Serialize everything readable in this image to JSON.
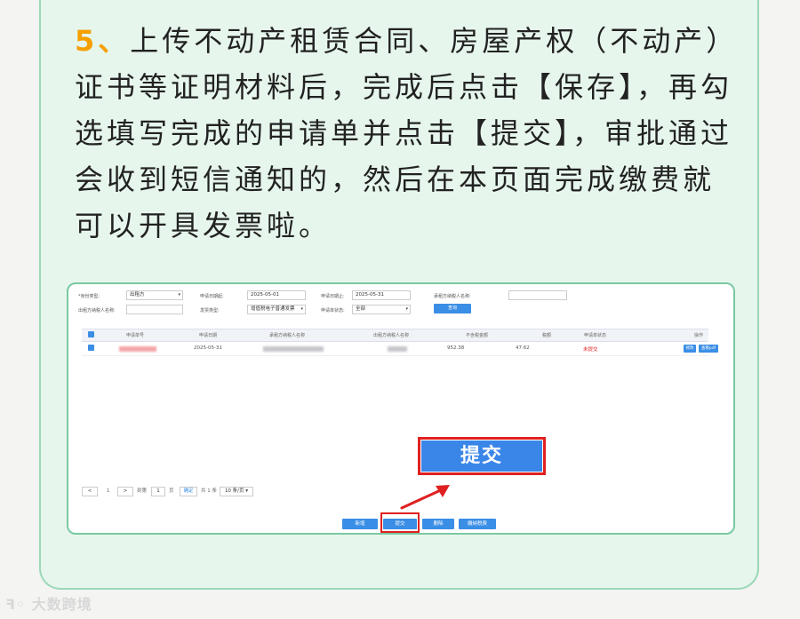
{
  "instruction": {
    "number": "5、",
    "text": "上传不动产租赁合同、房屋产权（不动产）证书等证明材料后，完成后点击【保存】，再勾选填写完成的申请单并点击【提交】，审批通过会收到短信通知的，然后在本页面完成缴费就可以开具发票啦。"
  },
  "form": {
    "row1": [
      {
        "label": "*身份类型:",
        "value": "出租方",
        "type": "select"
      },
      {
        "label": "申请日期起:",
        "value": "2025-05-01",
        "type": "input"
      },
      {
        "label": "申请日期止:",
        "value": "2025-05-31",
        "type": "input"
      },
      {
        "label": "承租方纳税人名称:",
        "value": "",
        "type": "input"
      }
    ],
    "row2": [
      {
        "label": "出租方纳税人名称:",
        "value": "",
        "type": "input"
      },
      {
        "label": "发票类型:",
        "value": "增值税电子普通发票",
        "type": "select"
      },
      {
        "label": "申请单状态:",
        "value": "全部",
        "type": "select"
      }
    ],
    "query_label": "查询"
  },
  "table": {
    "headers": [
      "申请单号",
      "申请日期",
      "承租方纳税人名称",
      "出租方纳税人名称",
      "不含税金额",
      "税额",
      "申请单状态",
      "操作"
    ],
    "row": {
      "date": "2025-05-31",
      "amount": "952.38",
      "tax": "47.62",
      "status": "未提交",
      "actions": [
        "修改",
        "查看pdf"
      ]
    }
  },
  "submit_callout": "提交",
  "pager": {
    "page": "1",
    "goto_label": "到第",
    "page_unit": "页",
    "confirm_label": "确定",
    "total": "共 1 条",
    "per_page": "10 条/页"
  },
  "bottom_buttons": [
    "新增",
    "提交",
    "删除",
    "缴纳税费"
  ],
  "watermark": "大数跨境",
  "colors": {
    "accent": "#3a8ee6",
    "highlight": "#e02020",
    "number": "#f5a000",
    "card_bg": "#e6f6ec"
  }
}
